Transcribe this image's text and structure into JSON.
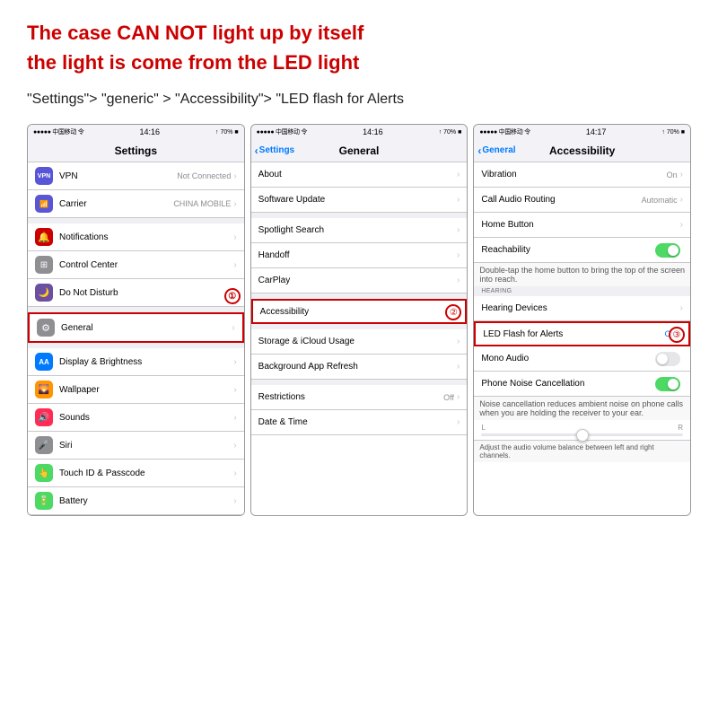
{
  "headline": {
    "line1": "The case CAN NOT light up by itself",
    "line2": "the light is come from the LED light"
  },
  "instruction": "\"Settings\"> \"generic\" > \"Accessibility\"> \"LED flash for Alerts",
  "screens": [
    {
      "id": "screen1",
      "step": "①",
      "status_left": "●●●●● 中国移动 令",
      "status_center": "14:16",
      "status_right": "↑ 70% ■",
      "nav_title": "Settings",
      "nav_back": null,
      "rows": [
        {
          "icon_class": "icon-vpn",
          "icon_text": "VPN",
          "label": "VPN",
          "value": "Not Connected",
          "has_chevron": true
        },
        {
          "icon_class": "icon-carrier",
          "icon_text": "📶",
          "label": "Carrier",
          "value": "CHINA MOBILE",
          "has_chevron": true
        },
        {
          "label": "",
          "divider": true
        },
        {
          "icon_class": "icon-notifications",
          "icon_text": "🔔",
          "label": "Notifications",
          "value": "",
          "has_chevron": true
        },
        {
          "icon_class": "icon-controlcenter",
          "icon_text": "⊞",
          "label": "Control Center",
          "value": "",
          "has_chevron": true
        },
        {
          "icon_class": "icon-donotdisturb",
          "icon_text": "🌙",
          "label": "Do Not Disturb",
          "value": "",
          "has_chevron": true,
          "highlighted": false,
          "badge": "①"
        },
        {
          "label": "",
          "divider": true
        },
        {
          "icon_class": "icon-general",
          "icon_text": "⚙",
          "label": "General",
          "value": "",
          "has_chevron": true,
          "highlighted": true
        },
        {
          "label": "",
          "divider": true
        },
        {
          "icon_class": "icon-display",
          "icon_text": "AA",
          "label": "Display & Brightness",
          "value": "",
          "has_chevron": true
        },
        {
          "icon_class": "icon-wallpaper",
          "icon_text": "🌄",
          "label": "Wallpaper",
          "value": "",
          "has_chevron": true
        },
        {
          "icon_class": "icon-sounds",
          "icon_text": "🔊",
          "label": "Sounds",
          "value": "",
          "has_chevron": true
        },
        {
          "icon_class": "icon-siri",
          "icon_text": "🎤",
          "label": "Siri",
          "value": "",
          "has_chevron": true
        },
        {
          "icon_class": "icon-touchid",
          "icon_text": "👆",
          "label": "Touch ID & Passcode",
          "value": "",
          "has_chevron": true
        },
        {
          "icon_class": "icon-battery",
          "icon_text": "🔋",
          "label": "Battery",
          "value": "",
          "has_chevron": true
        }
      ]
    },
    {
      "id": "screen2",
      "step": "②",
      "status_left": "●●●●● 中国移动 令",
      "status_center": "14:16",
      "status_right": "↑ 70% ■",
      "nav_title": "General",
      "nav_back": "Settings",
      "rows": [
        {
          "label": "About",
          "value": "",
          "has_chevron": true
        },
        {
          "label": "Software Update",
          "value": "",
          "has_chevron": true
        },
        {
          "label": "",
          "divider": true
        },
        {
          "label": "Spotlight Search",
          "value": "",
          "has_chevron": true
        },
        {
          "label": "Handoff",
          "value": "",
          "has_chevron": true
        },
        {
          "label": "CarPlay",
          "value": "",
          "has_chevron": true
        },
        {
          "label": "",
          "divider": true
        },
        {
          "label": "Accessibility",
          "value": "",
          "has_chevron": true,
          "highlighted": true
        },
        {
          "label": "",
          "divider": true
        },
        {
          "label": "Storage & iCloud Usage",
          "value": "",
          "has_chevron": true
        },
        {
          "label": "Background App Refresh",
          "value": "",
          "has_chevron": true
        },
        {
          "label": "",
          "divider": true
        },
        {
          "label": "Restrictions",
          "value": "Off",
          "has_chevron": true
        },
        {
          "label": "Date & Time",
          "value": "",
          "has_chevron": true
        }
      ]
    },
    {
      "id": "screen3",
      "step": "③",
      "status_left": "●●●●● 中国移动 令",
      "status_center": "14:17",
      "status_right": "↑ 70% ■",
      "nav_title": "Accessibility",
      "nav_back": "General",
      "rows": [
        {
          "label": "Vibration",
          "value": "On",
          "has_chevron": true
        },
        {
          "label": "Call Audio Routing",
          "value": "Automatic",
          "has_chevron": true
        },
        {
          "label": "Home Button",
          "value": "",
          "has_chevron": true
        },
        {
          "label": "Reachability",
          "toggle": "on"
        },
        {
          "label": "sub_reachability",
          "is_sub": true,
          "sub_text": "Double-tap the home button to bring the top of the screen into reach."
        },
        {
          "label": "HEARING",
          "is_section_header": true
        },
        {
          "label": "Hearing Devices",
          "value": "",
          "has_chevron": true
        },
        {
          "label": "LED Flash for Alerts",
          "value": "On",
          "has_chevron": true,
          "highlighted": true,
          "is_on_blue": true
        },
        {
          "label": "Mono Audio",
          "toggle": "off"
        },
        {
          "label": "Phone Noise Cancellation",
          "toggle": "on"
        },
        {
          "label": "sub_noise",
          "is_sub": true,
          "sub_text": "Noise cancellation reduces ambient noise on phone calls when you are holding the receiver to your ear."
        },
        {
          "label": "slider",
          "is_slider": true
        }
      ]
    }
  ]
}
